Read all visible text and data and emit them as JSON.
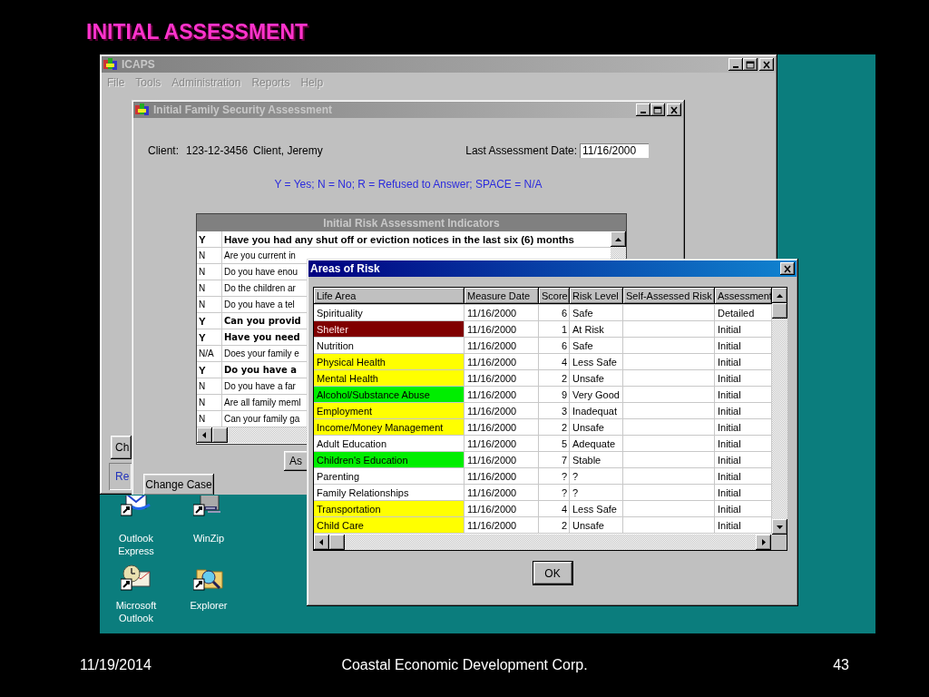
{
  "slide": {
    "title": "INITIAL ASSESSMENT",
    "footer": {
      "date": "11/19/2014",
      "organization": "Coastal Economic Development Corp.",
      "page": "43"
    }
  },
  "desktop_icons": [
    {
      "label": "Outlook Express",
      "kind": "mail"
    },
    {
      "label": "WinZip",
      "kind": "archive"
    },
    {
      "label": "Microsoft Outlook",
      "kind": "organizer"
    },
    {
      "label": "Explorer",
      "kind": "explorer"
    }
  ],
  "main_window": {
    "title": "ICAPS",
    "menu": [
      {
        "label": "File",
        "disabled": true
      },
      {
        "label": "Tools",
        "disabled": true
      },
      {
        "label": "Administration",
        "disabled": true
      },
      {
        "label": "Reports",
        "disabled": true
      },
      {
        "label": "Help",
        "disabled": true
      }
    ],
    "side_button": "Ch",
    "side_text": "Re"
  },
  "assessment_window": {
    "title": "Initial Family Security Assessment",
    "client_label": "Client:",
    "client_id": "123-12-3456",
    "client_name": "Client, Jeremy",
    "last_date_label": "Last Assessment Date:",
    "last_date": "11/16/2000",
    "legend": "Y = Yes; N = No; R = Refused to Answer; SPACE = N/A",
    "indicators": {
      "title": "Initial Risk Assessment Indicators",
      "rows": [
        {
          "answer": "Y",
          "question": "Have you had any shut off or eviction notices in the last six (6) months",
          "emphasized": true
        },
        {
          "answer": "N",
          "question": "Are you current in",
          "emphasized": false
        },
        {
          "answer": "N",
          "question": "Do you have enou",
          "emphasized": false
        },
        {
          "answer": "N",
          "question": "Do the children ar",
          "emphasized": false
        },
        {
          "answer": "N",
          "question": "Do you have a tel",
          "emphasized": false
        },
        {
          "answer": "Y",
          "question": "Can you provid",
          "emphasized": true
        },
        {
          "answer": "Y",
          "question": "Have you need",
          "emphasized": true
        },
        {
          "answer": "N/A",
          "question": "Does your family e",
          "emphasized": false
        },
        {
          "answer": "Y",
          "question": "Do you have a",
          "emphasized": true
        },
        {
          "answer": "N",
          "question": "Do you have a far",
          "emphasized": false
        },
        {
          "answer": "N",
          "question": "Are all family meml",
          "emphasized": false
        },
        {
          "answer": "N",
          "question": "Can your family ga",
          "emphasized": false
        }
      ]
    },
    "assess_button": "As",
    "change_case_button": "Change Case"
  },
  "risk_dialog": {
    "title": "Areas of Risk",
    "table": {
      "columns": [
        "Life Area",
        "Measure Date",
        "Score",
        "Risk Level",
        "Self-Assessed Risk",
        "Assessment"
      ],
      "rows": [
        {
          "life_area": "Spirituality",
          "color": "#ffffff",
          "measure_date": "11/16/2000",
          "score": "6",
          "risk_level": "Safe",
          "assessment": "Detailed"
        },
        {
          "life_area": "Shelter",
          "color": "#800000",
          "measure_date": "11/16/2000",
          "score": "1",
          "risk_level": "At Risk",
          "assessment": "Initial"
        },
        {
          "life_area": "Nutrition",
          "color": "#ffffff",
          "measure_date": "11/16/2000",
          "score": "6",
          "risk_level": "Safe",
          "assessment": "Initial"
        },
        {
          "life_area": "Physical Health",
          "color": "#ffff00",
          "measure_date": "11/16/2000",
          "score": "4",
          "risk_level": "Less Safe",
          "assessment": "Initial"
        },
        {
          "life_area": "Mental Health",
          "color": "#ffff00",
          "measure_date": "11/16/2000",
          "score": "2",
          "risk_level": "Unsafe",
          "assessment": "Initial"
        },
        {
          "life_area": "Alcohol/Substance Abuse",
          "color": "#00ee00",
          "measure_date": "11/16/2000",
          "score": "9",
          "risk_level": "Very Good",
          "assessment": "Initial"
        },
        {
          "life_area": "Employment",
          "color": "#ffff00",
          "measure_date": "11/16/2000",
          "score": "3",
          "risk_level": "Inadequat",
          "assessment": "Initial"
        },
        {
          "life_area": "Income/Money Management",
          "color": "#ffff00",
          "measure_date": "11/16/2000",
          "score": "2",
          "risk_level": "Unsafe",
          "assessment": "Initial"
        },
        {
          "life_area": "Adult Education",
          "color": "#ffffff",
          "measure_date": "11/16/2000",
          "score": "5",
          "risk_level": "Adequate",
          "assessment": "Initial"
        },
        {
          "life_area": "Children's Education",
          "color": "#00ee00",
          "measure_date": "11/16/2000",
          "score": "7",
          "risk_level": "Stable",
          "assessment": "Initial"
        },
        {
          "life_area": "Parenting",
          "color": "#ffffff",
          "measure_date": "11/16/2000",
          "score": "?",
          "risk_level": "?",
          "assessment": "Initial"
        },
        {
          "life_area": "Family Relationships",
          "color": "#ffffff",
          "measure_date": "11/16/2000",
          "score": "?",
          "risk_level": "?",
          "assessment": "Initial"
        },
        {
          "life_area": "Transportation",
          "color": "#ffff00",
          "measure_date": "11/16/2000",
          "score": "4",
          "risk_level": "Less Safe",
          "assessment": "Initial"
        },
        {
          "life_area": "Child Care",
          "color": "#ffff00",
          "measure_date": "11/16/2000",
          "score": "2",
          "risk_level": "Unsafe",
          "assessment": "Initial"
        }
      ]
    },
    "ok_button": "OK"
  }
}
